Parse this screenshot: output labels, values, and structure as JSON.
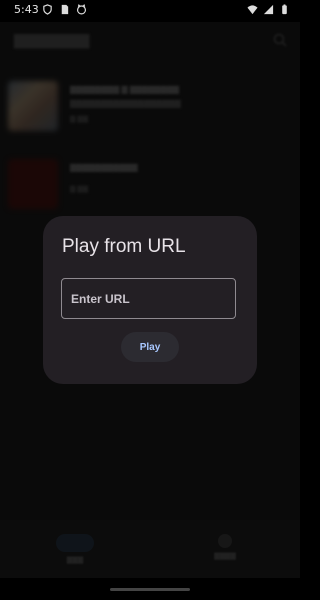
{
  "status_bar": {
    "time": "5:43",
    "left_icons": [
      "vpn-shield-icon",
      "sd-card-icon",
      "cat-face-icon"
    ],
    "right_icons": [
      "wifi-icon",
      "signal-icon",
      "battery-icon"
    ]
  },
  "dialog": {
    "title": "Play from URL",
    "url_placeholder": "Enter URL",
    "url_value": "",
    "play_label": "Play"
  },
  "colors": {
    "dialog_bg": "#231f24",
    "play_text": "#a9c8ff",
    "scrim": "rgba(0,0,0,0.45)"
  }
}
